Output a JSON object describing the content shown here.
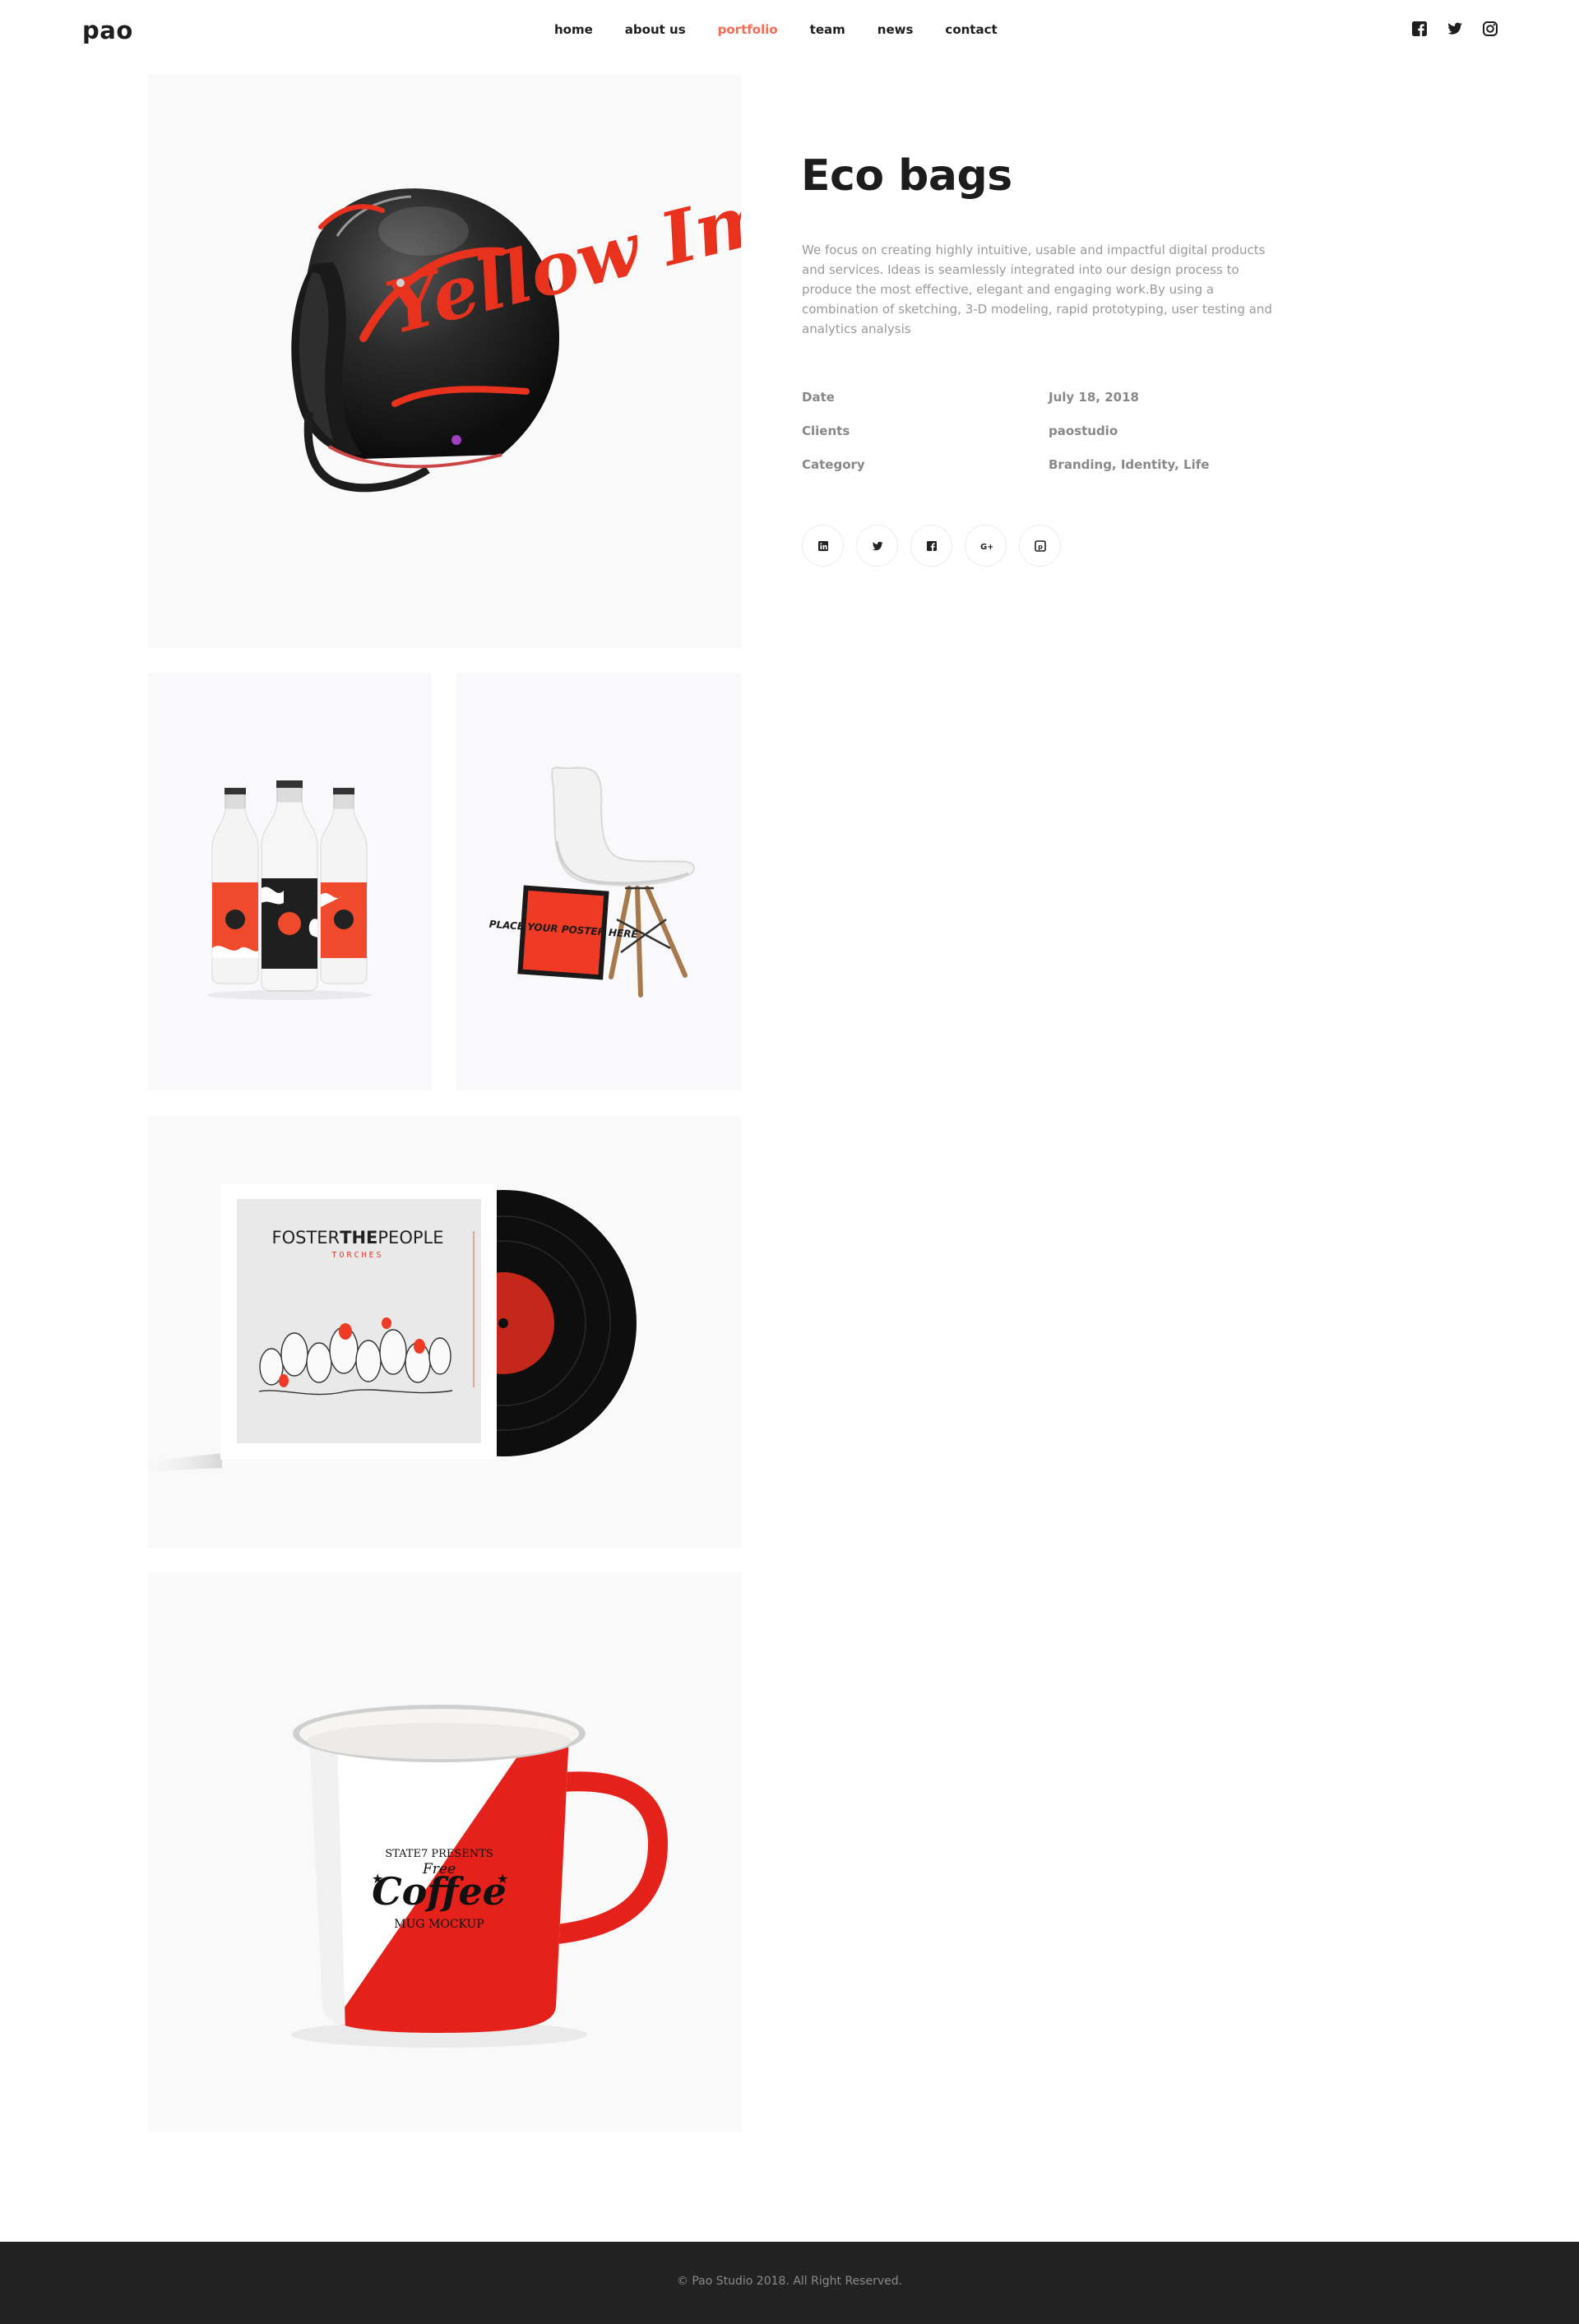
{
  "brand": {
    "logo": "pao"
  },
  "nav": {
    "items": [
      {
        "label": "home",
        "active": false
      },
      {
        "label": "about us",
        "active": false
      },
      {
        "label": "portfolio",
        "active": true
      },
      {
        "label": "team",
        "active": false
      },
      {
        "label": "news",
        "active": false
      },
      {
        "label": "contact",
        "active": false
      }
    ],
    "accent_color": "#f26b55"
  },
  "header_socials": [
    "facebook-icon",
    "twitter-icon",
    "instagram-icon"
  ],
  "gallery": {
    "helmet": {
      "text": "Yellow Images"
    },
    "chair": {
      "poster_text": "PLACE YOUR POSTER HERE"
    },
    "vinyl": {
      "band_part1": "FOSTER",
      "band_part2": "THE",
      "band_part3": "PEOPLE",
      "album": "TORCHES"
    },
    "mug": {
      "top": "STATE7 PRESENTS",
      "free": "Free",
      "coffee": "Coffee",
      "bottom": "MUG MOCKUP"
    }
  },
  "project": {
    "title": "Eco bags",
    "description": "We focus on creating highly intuitive, usable and impactful digital products and services. Ideas is seamlessly integrated into our design process to produce the most effective, elegant and engaging work.By using a combination of sketching, 3-D modeling, rapid prototyping, user testing and analytics analysis",
    "meta": [
      {
        "label": "Date",
        "value": "July 18, 2018"
      },
      {
        "label": "Clients",
        "value": "paostudio"
      },
      {
        "label": "Category",
        "value": "Branding, Identity, Life"
      }
    ],
    "share": [
      "linkedin-icon",
      "twitter-icon",
      "facebook-icon",
      "google-plus-icon",
      "pinterest-icon"
    ]
  },
  "footer": {
    "copyright": "© Pao Studio 2018. All Right Reserved."
  }
}
